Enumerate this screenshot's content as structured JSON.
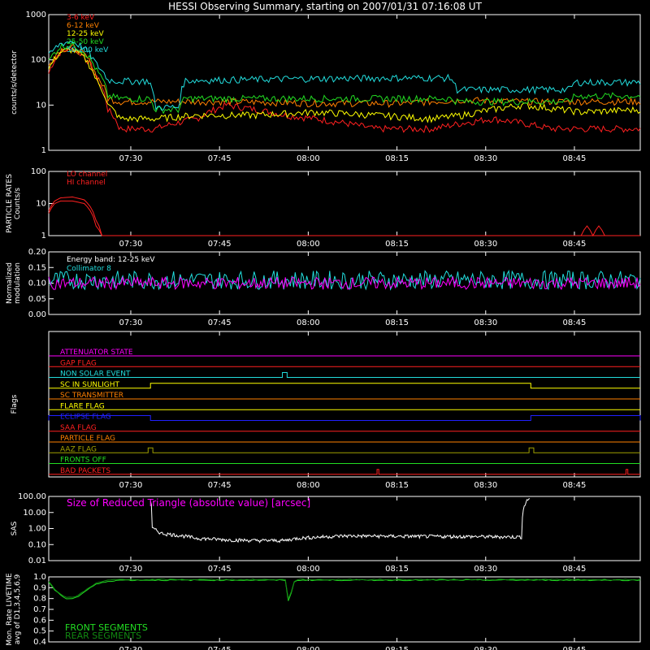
{
  "title": "HESSI Observing Summary, starting on 2007/01/31 07:16:08 UT",
  "time_ticks": [
    "07:30",
    "07:45",
    "08:00",
    "08:15",
    "08:30",
    "08:45"
  ],
  "colors": {
    "red": "#ff2020",
    "orange": "#ff8000",
    "yellow": "#ffff00",
    "green": "#22dd22",
    "cyan": "#22dddd",
    "magenta": "#ff00ff",
    "blue": "#2020ff",
    "white": "#ffffff",
    "olive": "#a0a000"
  },
  "chart_data": [
    {
      "id": "counts",
      "type": "line",
      "ylabel": "counts/s/detector",
      "yscale": "log",
      "ylim": [
        1,
        1000
      ],
      "yticks": [
        "1",
        "10",
        "100",
        "1000"
      ],
      "x_unit": "minutes since 07:16:08 UT",
      "legend_placement": "top-left",
      "series": [
        {
          "name": "3-6 keV",
          "color": "#ff2020",
          "x": [
            0,
            2,
            4,
            6,
            8,
            10,
            12,
            14,
            18,
            25,
            30,
            35,
            40,
            45,
            55,
            60,
            65,
            70,
            75,
            80,
            85,
            90,
            95,
            100
          ],
          "y": [
            50,
            150,
            180,
            120,
            40,
            8,
            3,
            3,
            3,
            5,
            10,
            8,
            6,
            5,
            3,
            3,
            3,
            4,
            5,
            4,
            3,
            3,
            3,
            3
          ]
        },
        {
          "name": "6-12 keV",
          "color": "#ff8000",
          "x": [
            0,
            2,
            4,
            6,
            8,
            10,
            12,
            18,
            30,
            45,
            60,
            70,
            80,
            90,
            100
          ],
          "y": [
            70,
            170,
            190,
            130,
            45,
            14,
            12,
            12,
            12,
            11,
            11,
            13,
            12,
            12,
            12
          ]
        },
        {
          "name": "12-25 keV",
          "color": "#ffff00",
          "x": [
            0,
            2,
            4,
            6,
            8,
            10,
            12,
            18,
            25,
            35,
            45,
            55,
            65,
            70,
            80,
            90,
            100
          ],
          "y": [
            60,
            150,
            170,
            110,
            35,
            10,
            5,
            5,
            6,
            6,
            7,
            6,
            5,
            6,
            10,
            7,
            8
          ]
        },
        {
          "name": "25-50 keV",
          "color": "#22dd22",
          "x": [
            0,
            2,
            4,
            6,
            8,
            10,
            12,
            17,
            18,
            22,
            23,
            40,
            60,
            68,
            69,
            80,
            88,
            89,
            100
          ],
          "y": [
            90,
            200,
            220,
            150,
            60,
            16,
            14,
            14,
            8,
            8,
            14,
            14,
            14,
            14,
            12,
            12,
            12,
            16,
            16
          ]
        },
        {
          "name": "50-100 keV",
          "color": "#22dddd",
          "x": [
            0,
            2,
            4,
            6,
            8,
            10,
            12,
            17,
            18,
            22,
            23,
            40,
            60,
            68,
            69,
            80,
            88,
            89,
            100
          ],
          "y": [
            120,
            230,
            260,
            180,
            80,
            36,
            34,
            34,
            9,
            9,
            35,
            38,
            40,
            40,
            22,
            22,
            22,
            32,
            32
          ]
        }
      ]
    },
    {
      "id": "particle",
      "type": "line",
      "ylabel": "PARTICLE RATES\nCounts/s",
      "yscale": "log",
      "ylim": [
        1,
        100
      ],
      "yticks": [
        "1",
        "10",
        "100"
      ],
      "series": [
        {
          "name": "LO channel",
          "color": "#ff2020",
          "x": [
            0,
            1,
            2,
            4,
            6,
            7,
            8,
            9,
            20,
            90,
            91,
            92,
            93,
            94,
            100
          ],
          "y": [
            6,
            12,
            15,
            16,
            13,
            8,
            3,
            1,
            1,
            1,
            2,
            1,
            2,
            1,
            1
          ]
        },
        {
          "name": "HI channel",
          "color": "#ff2020",
          "x": [
            0,
            1,
            2,
            4,
            6,
            7,
            8,
            9,
            100
          ],
          "y": [
            5,
            10,
            12,
            12,
            10,
            6,
            2,
            1,
            1
          ]
        }
      ]
    },
    {
      "id": "modulation",
      "type": "line",
      "ylabel": "Normalized\nmodulation",
      "ylim": [
        0,
        0.2
      ],
      "yticks": [
        "0.00",
        "0.05",
        "0.10",
        "0.15",
        "0.20"
      ],
      "annotations": [
        "Energy band: 12-25 keV",
        "Collimator 8"
      ],
      "series": [
        {
          "name": "Collimator 8",
          "color": "#22dddd",
          "mean": 0.11,
          "spread": 0.03
        },
        {
          "name": "",
          "color": "#ff00ff",
          "mean": 0.1,
          "spread": 0.02
        }
      ]
    },
    {
      "id": "flags",
      "type": "line",
      "ylabel": "Flags",
      "flags": [
        {
          "label": "ATTENUATOR STATE",
          "color": "#ff00ff",
          "pulses": []
        },
        {
          "label": "GAP FLAG",
          "color": "#ff2020",
          "pulses": []
        },
        {
          "label": "NON SOLAR EVENT",
          "color": "#22dddd",
          "pulses": [
            [
              39.5,
              40.3
            ]
          ]
        },
        {
          "label": "SC IN SUNLIGHT",
          "color": "#ffff00",
          "pulses": [
            [
              17.2,
              81.5
            ]
          ]
        },
        {
          "label": "SC TRANSMITTER",
          "color": "#ff8000",
          "pulses": []
        },
        {
          "label": "FLARE FLAG",
          "color": "#ffff00",
          "pulses": []
        },
        {
          "label": "ECLIPSE FLAG",
          "color": "#2020ff",
          "pulses": [
            [
              0,
              17.2
            ],
            [
              81.5,
              100
            ]
          ]
        },
        {
          "label": "SAA FLAG",
          "color": "#ff2020",
          "pulses": []
        },
        {
          "label": "PARTICLE FLAG",
          "color": "#ff8000",
          "pulses": []
        },
        {
          "label": "AAZ FLAG",
          "color": "#a0a000",
          "pulses": [
            [
              16.8,
              17.6
            ],
            [
              81.2,
              82
            ]
          ]
        },
        {
          "label": "FRONTS OFF",
          "color": "#22dd22",
          "pulses": []
        },
        {
          "label": "BAD PACKETS",
          "color": "#ff2020",
          "pulses": [
            [
              55.5,
              55.8
            ],
            [
              97.6,
              97.9
            ]
          ]
        }
      ]
    },
    {
      "id": "sas",
      "type": "line",
      "ylabel": "SAS",
      "yscale": "log",
      "ylim": [
        0.01,
        100
      ],
      "yticks": [
        "0.01",
        "0.10",
        "1.00",
        "10.00",
        "100.00"
      ],
      "annotation": "Size of Reduced Triangle (absolute value) [arcsec]",
      "annotation_color": "#ff00ff",
      "series": [
        {
          "name": "",
          "color": "#ffffff",
          "x": [
            17.2,
            17.5,
            19,
            25,
            30,
            35,
            40,
            42,
            46,
            50,
            60,
            70,
            80,
            81.3
          ],
          "y": [
            60,
            1,
            0.5,
            0.25,
            0.2,
            0.18,
            0.18,
            0.25,
            0.3,
            0.35,
            0.33,
            0.32,
            0.3,
            80
          ]
        }
      ]
    },
    {
      "id": "livetime",
      "type": "line",
      "ylabel": "Mon. Rate LIVETIME\navg of D1,3,4,5,6,9",
      "ylim": [
        0.4,
        1.0
      ],
      "yticks": [
        "0.4",
        "0.5",
        "0.6",
        "0.7",
        "0.8",
        "0.9",
        "1.0"
      ],
      "legend_placement": "bottom-left",
      "series": [
        {
          "name": "FRONT SEGMENTS",
          "color": "#22dd22",
          "x": [
            0,
            1,
            2,
            3,
            4,
            5,
            6,
            7,
            8,
            10,
            12,
            15,
            40,
            40.5,
            41,
            41.5,
            42,
            100
          ],
          "y": [
            0.95,
            0.88,
            0.83,
            0.8,
            0.8,
            0.82,
            0.86,
            0.9,
            0.93,
            0.96,
            0.97,
            0.97,
            0.97,
            0.78,
            0.85,
            0.95,
            0.97,
            0.97
          ]
        },
        {
          "name": "REAR SEGMENTS",
          "color": "#118811",
          "x": [
            0,
            1,
            2,
            3,
            4,
            5,
            6,
            7,
            8,
            10,
            12,
            15,
            40,
            40.5,
            41,
            41.5,
            42,
            100
          ],
          "y": [
            0.96,
            0.89,
            0.84,
            0.81,
            0.81,
            0.83,
            0.87,
            0.91,
            0.94,
            0.97,
            0.975,
            0.975,
            0.975,
            0.8,
            0.86,
            0.96,
            0.975,
            0.975
          ]
        }
      ]
    }
  ]
}
